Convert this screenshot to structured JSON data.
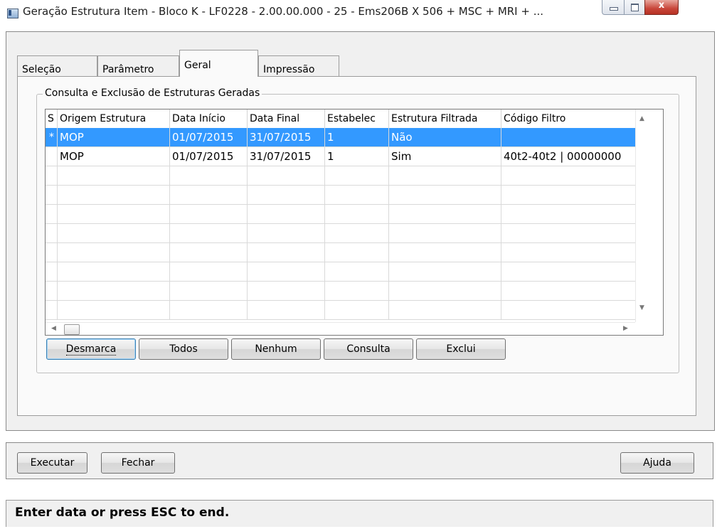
{
  "window": {
    "title": "Geração Estrutura Item - Bloco K - LF0228 - 2.00.00.000 - 25 - Ems206B X 506 + MSC + MRI + ...",
    "close_glyph": "x"
  },
  "tabs": [
    {
      "label": "Seleção",
      "active": false
    },
    {
      "label": "Parâmetro",
      "active": false
    },
    {
      "label": "Geral",
      "active": true
    },
    {
      "label": "Impressão",
      "active": false
    }
  ],
  "group": {
    "label": "Consulta e Exclusão de Estruturas Geradas"
  },
  "grid": {
    "columns": [
      "S",
      "Origem Estrutura",
      "Data Início",
      "Data Final",
      "Estabelec",
      "Estrutura Filtrada",
      "Código Filtro"
    ],
    "rows": [
      {
        "s": "*",
        "origem": "MOP",
        "inicio": "01/07/2015",
        "final": "31/07/2015",
        "estab": "1",
        "filtrada": "Não",
        "codigo": "",
        "selected": true
      },
      {
        "s": "",
        "origem": "MOP",
        "inicio": "01/07/2015",
        "final": "31/07/2015",
        "estab": "1",
        "filtrada": "Sim",
        "codigo": "40t2-40t2 | 00000000",
        "selected": false
      }
    ],
    "arrows": {
      "up": "▲",
      "down": "▼",
      "left": "◀",
      "right": "▶"
    }
  },
  "actions": {
    "desmarca": "Desmarca",
    "todos": "Todos",
    "nenhum": "Nenhum",
    "consulta": "Consulta",
    "exclui": "Exclui"
  },
  "footer": {
    "executar": "Executar",
    "fechar": "Fechar",
    "ajuda": "Ajuda"
  },
  "status": {
    "text": "Enter data or press ESC to end."
  },
  "colors": {
    "selection": "#3399ff",
    "background": "#f0f0f0"
  }
}
